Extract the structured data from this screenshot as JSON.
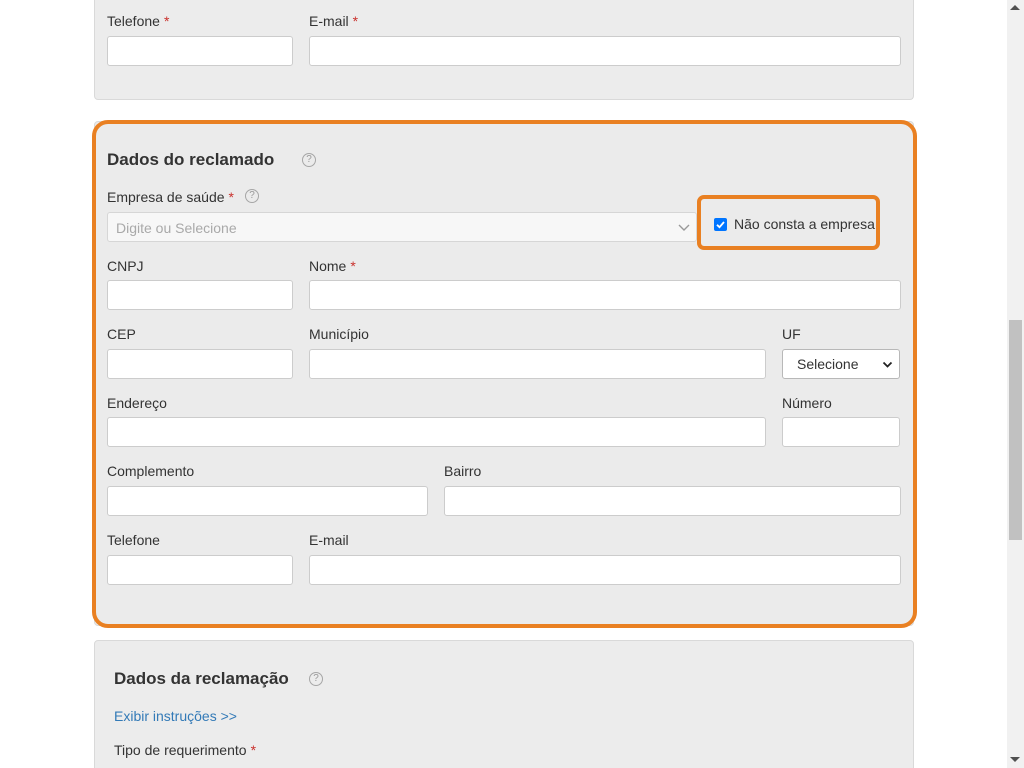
{
  "top_section": {
    "phone_label": "Telefone",
    "email_label": "E-mail",
    "required_mark": "*"
  },
  "respondent_section": {
    "title": "Dados do reclamado",
    "help": "?",
    "company_label": "Empresa de saúde",
    "company_placeholder": "Digite ou Selecione",
    "not_listed_label": "Não consta a empresa",
    "not_listed_checked": true,
    "cnpj_label": "CNPJ",
    "name_label": "Nome",
    "cep_label": "CEP",
    "city_label": "Município",
    "uf_label": "UF",
    "uf_selected": "Selecione",
    "address_label": "Endereço",
    "number_label": "Número",
    "complement_label": "Complemento",
    "district_label": "Bairro",
    "phone_label": "Telefone",
    "email_label": "E-mail",
    "required_mark": "*"
  },
  "complaint_section": {
    "title": "Dados da reclamação",
    "help": "?",
    "instructions_link": "Exibir instruções >>",
    "request_type_label": "Tipo de requerimento",
    "required_mark": "*"
  },
  "colors": {
    "highlight": "#e98022",
    "required": "#c9302c",
    "link": "#337ab7",
    "checkbox": "#0075ff"
  }
}
